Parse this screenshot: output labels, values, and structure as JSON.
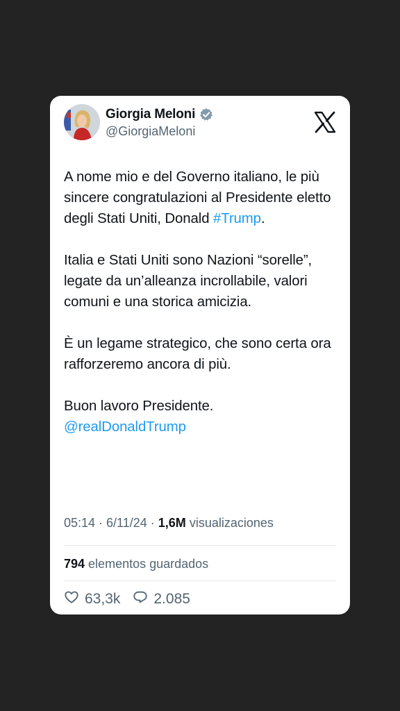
{
  "author": {
    "display_name": "Giorgia Meloni",
    "handle": "@GiorgiaMeloni",
    "avatar_icon": "profile-photo"
  },
  "brand": {
    "logo": "x-logo-icon"
  },
  "tweet": {
    "p1_text": "A nome mio e del Governo italiano, le più sincere congratulazioni al Presidente eletto degli Stati Uniti, Donald ",
    "p1_hashtag": "#Trump",
    "p1_end": ".",
    "p2": "Italia e Stati Uniti sono Nazioni “sorelle”, legate da un’alleanza incrollabile, valori comuni e una storica amicizia.",
    "p3": "È un legame strategico, che sono certa ora rafforzeremo ancora di più.",
    "p4_text": "Buon lavoro Presidente.",
    "p4_mention": "@realDonaldTrump"
  },
  "meta": {
    "time": "05:14",
    "sep1": " · ",
    "date": "6/11/24",
    "sep2": " · ",
    "views_count": "1,6M",
    "views_label": " visualizaciones"
  },
  "bookmarks": {
    "count": "794",
    "label": " elementos guardados"
  },
  "actions": {
    "likes": "63,3k",
    "replies": "2.085"
  },
  "colors": {
    "background": "#232323",
    "card": "#ffffff",
    "link": "#1d9bf0",
    "secondary_text": "#536471",
    "primary_text": "#0f1419",
    "verified_badge": "#829aab"
  }
}
